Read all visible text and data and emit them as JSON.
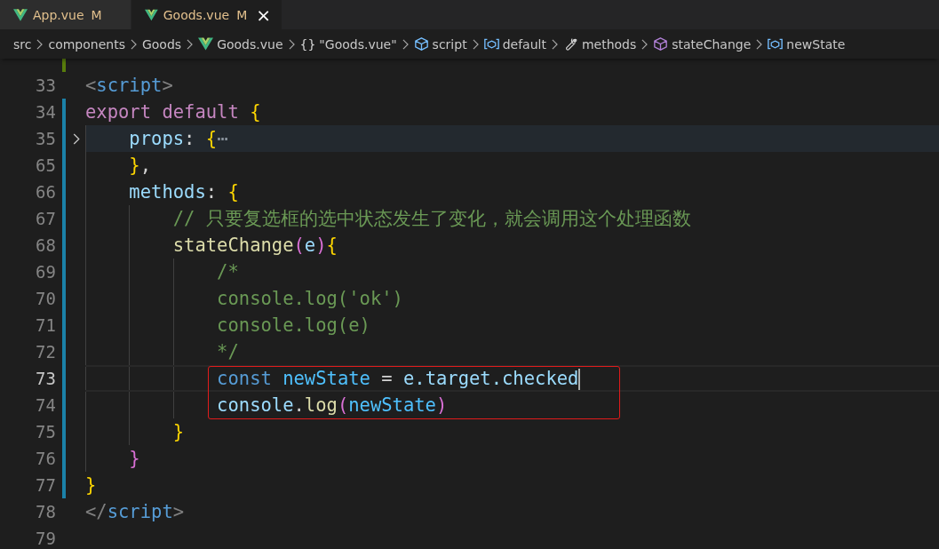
{
  "tabs": [
    {
      "label": "App.vue",
      "badge": "M",
      "selected": false
    },
    {
      "label": "Goods.vue",
      "badge": "M",
      "close": "×",
      "selected": true
    }
  ],
  "breadcrumbs": [
    {
      "label": "src"
    },
    {
      "label": "components"
    },
    {
      "label": "Goods"
    },
    {
      "label": "Goods.vue",
      "kind": "vue"
    },
    {
      "label": "\"Goods.vue\"",
      "kind": "braces",
      "icon_text": "{}"
    },
    {
      "label": "script",
      "kind": "module"
    },
    {
      "label": "default",
      "kind": "variable"
    },
    {
      "label": "methods",
      "kind": "property"
    },
    {
      "label": "stateChange",
      "kind": "method"
    },
    {
      "label": "newState",
      "kind": "variable"
    }
  ],
  "lines": [
    {
      "kind": "added"
    },
    {
      "number": "33",
      "kind": "unchanged",
      "tokens": [
        {
          "text": "<",
          "kind": "angle"
        },
        {
          "text": "script",
          "kind": "tag"
        },
        {
          "text": ">",
          "kind": "angle"
        }
      ]
    },
    {
      "number": "34",
      "kind": "modified",
      "tokens": [
        {
          "text": "export default ",
          "kind": "keyword"
        },
        {
          "text": "{",
          "kind": "brace"
        }
      ]
    },
    {
      "number": "35",
      "kind": "modified",
      "folded": true,
      "tokens": [
        {
          "text": "    props",
          "kind": "property"
        },
        {
          "text": ": ",
          "kind": "plain"
        },
        {
          "text": "{",
          "kind": "brace"
        },
        {
          "text": "⋯",
          "kind": "ellipsis"
        }
      ]
    },
    {
      "number": "65",
      "kind": "modified",
      "tokens": [
        {
          "text": "    }",
          "kind": "brace"
        },
        {
          "text": ",",
          "kind": "plain"
        }
      ]
    },
    {
      "number": "66",
      "kind": "modified",
      "tokens": [
        {
          "text": "    methods",
          "kind": "property"
        },
        {
          "text": ": ",
          "kind": "plain"
        },
        {
          "text": "{",
          "kind": "brace"
        }
      ]
    },
    {
      "number": "67",
      "kind": "modified",
      "tokens": [
        {
          "text": "        // 只要复选框的选中状态发生了变化，就会调用这个处理函数",
          "kind": "comment"
        }
      ]
    },
    {
      "number": "68",
      "kind": "modified",
      "tokens": [
        {
          "text": "        stateChange",
          "kind": "function"
        },
        {
          "text": "(",
          "kind": "paren"
        },
        {
          "text": "e",
          "kind": "param"
        },
        {
          "text": ")",
          "kind": "paren"
        },
        {
          "text": "{",
          "kind": "bracematch"
        }
      ]
    },
    {
      "number": "69",
      "kind": "modified",
      "tokens": [
        {
          "text": "            /*",
          "kind": "comment"
        }
      ]
    },
    {
      "number": "70",
      "kind": "modified",
      "tokens": [
        {
          "text": "            console.log('ok')",
          "kind": "comment"
        }
      ]
    },
    {
      "number": "71",
      "kind": "modified",
      "tokens": [
        {
          "text": "            console.log(e)",
          "kind": "comment"
        }
      ]
    },
    {
      "number": "72",
      "kind": "modified",
      "tokens": [
        {
          "text": "            */",
          "kind": "comment"
        }
      ]
    },
    {
      "number": "73",
      "kind": "modified",
      "current": true,
      "boxed": true,
      "tokens": [
        {
          "text": "            const ",
          "kind": "storage"
        },
        {
          "text": "newState",
          "kind": "constant"
        },
        {
          "text": " = ",
          "kind": "plain"
        },
        {
          "text": "e.target.checked",
          "kind": "param"
        }
      ]
    },
    {
      "number": "74",
      "kind": "modified",
      "current": false,
      "boxed": true,
      "tokens": [
        {
          "text": "            console",
          "kind": "param"
        },
        {
          "text": ".",
          "kind": "plain"
        },
        {
          "text": "log",
          "kind": "function"
        },
        {
          "text": "(",
          "kind": "paren2"
        },
        {
          "text": "newState",
          "kind": "constant"
        },
        {
          "text": ")",
          "kind": "paren2"
        }
      ]
    },
    {
      "number": "75",
      "kind": "modified",
      "tokens": [
        {
          "text": "        }",
          "kind": "bracematch"
        }
      ]
    },
    {
      "number": "76",
      "kind": "modified",
      "tokens": [
        {
          "text": "    }",
          "kind": "brace2"
        }
      ]
    },
    {
      "number": "77",
      "kind": "modified",
      "tokens": [
        {
          "text": "}",
          "kind": "brace"
        }
      ]
    },
    {
      "number": "78",
      "kind": "unchanged",
      "tokens": [
        {
          "text": "</",
          "kind": "angle"
        },
        {
          "text": "script",
          "kind": "tag"
        },
        {
          "text": ">",
          "kind": "angle"
        }
      ]
    },
    {
      "number": "79",
      "kind": "unchanged"
    }
  ]
}
